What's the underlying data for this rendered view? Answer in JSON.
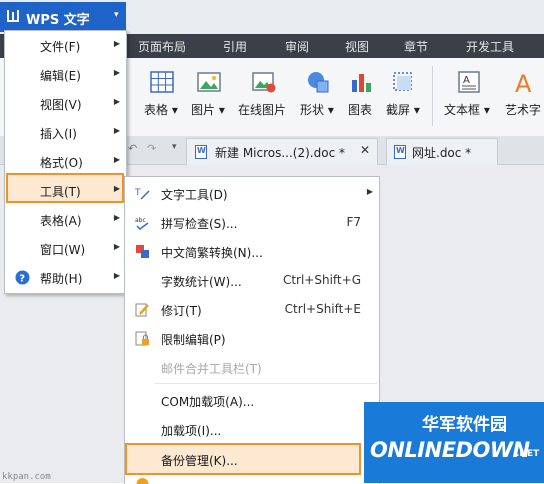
{
  "app": {
    "title": "WPS 文字"
  },
  "ribbon_tabs": [
    "页面布局",
    "引用",
    "审阅",
    "视图",
    "章节",
    "开发工具"
  ],
  "ribbon_buttons": [
    {
      "label": "表格",
      "icon": "table-icon"
    },
    {
      "label": "图片",
      "icon": "picture-icon"
    },
    {
      "label": "在线图片",
      "icon": "online-picture-icon"
    },
    {
      "label": "形状",
      "icon": "shape-icon"
    },
    {
      "label": "图表",
      "icon": "chart-icon"
    },
    {
      "label": "截屏",
      "icon": "screenshot-icon"
    },
    {
      "label": "文本框",
      "icon": "textbox-icon"
    },
    {
      "label": "艺术字",
      "icon": "wordart-icon"
    }
  ],
  "document_tabs": [
    {
      "label": "新建 Micros...(2).doc *",
      "close": "✕"
    },
    {
      "label": "网址.doc *"
    }
  ],
  "main_menu": [
    {
      "label": "文件(F)"
    },
    {
      "label": "编辑(E)"
    },
    {
      "label": "视图(V)"
    },
    {
      "label": "插入(I)"
    },
    {
      "label": "格式(O)"
    },
    {
      "label": "工具(T)"
    },
    {
      "label": "表格(A)"
    },
    {
      "label": "窗口(W)"
    },
    {
      "label": "帮助(H)"
    }
  ],
  "tools_submenu": [
    {
      "label": "文字工具(D)",
      "shortcut": ""
    },
    {
      "label": "拼写检查(S)...",
      "shortcut": "F7"
    },
    {
      "label": "中文简繁转换(N)...",
      "shortcut": ""
    },
    {
      "label": "字数统计(W)...",
      "shortcut": "Ctrl+Shift+G"
    },
    {
      "label": "修订(T)",
      "shortcut": "Ctrl+Shift+E"
    },
    {
      "label": "限制编辑(P)",
      "shortcut": ""
    },
    {
      "label": "邮件合并工具栏(T)",
      "shortcut": ""
    },
    {
      "label": "COM加载项(A)...",
      "shortcut": ""
    },
    {
      "label": "加载项(I)...",
      "shortcut": ""
    },
    {
      "label": "备份管理(K)...",
      "shortcut": ""
    }
  ],
  "watermark": {
    "cn": "华军软件园",
    "en": "ONLINEDOWN",
    "suffix": ".NET"
  },
  "source_mark": "kkpan.com",
  "colors": {
    "accent": "#1e64c8",
    "highlight_border": "#f0922a",
    "highlight_fill": "#fde9d1",
    "watermark_bg": "#1a7ad8"
  }
}
